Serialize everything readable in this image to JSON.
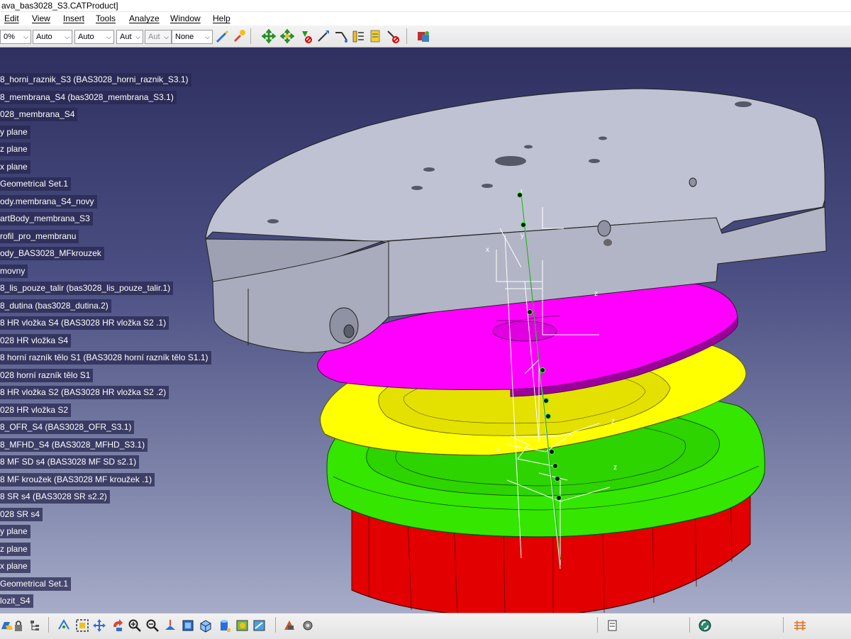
{
  "window": {
    "title": "ava_bas3028_S3.CATProduct]"
  },
  "menu": [
    "Edit",
    "View",
    "Insert",
    "Tools",
    "Analyze",
    "Window",
    "Help"
  ],
  "toolbar": {
    "zoom_value": "0%",
    "selects": [
      {
        "value": "Auto",
        "disabled": false
      },
      {
        "value": "Auto",
        "disabled": false
      },
      {
        "value": "Aut",
        "disabled": false
      },
      {
        "value": "Aut",
        "disabled": true
      },
      {
        "value": "None",
        "disabled": false
      }
    ]
  },
  "tree": {
    "items": [
      "8_horni_raznik_S3 (BAS3028_horni_raznik_S3.1)",
      "8_membrana_S4 (bas3028_membrana_S3.1)",
      "028_membrana_S4",
      "y plane",
      "z plane",
      "x plane",
      "Geometrical Set.1",
      "ody.membrana_S4_novy",
      "artBody_membrana_S3",
      "rofil_pro_membranu",
      "ody_BAS3028_MFkrouzek",
      "movny",
      "8_lis_pouze_talir (bas3028_lis_pouze_talir.1)",
      "8_dutina (bas3028_dutina.2)",
      "8 HR vložka S4 (BAS3028 HR vložka S2 .1)",
      "028 HR vložka S4",
      "8 horní razník tělo S1 (BAS3028 horní razník tělo S1.1)",
      "028 horní razník tělo S1",
      "8 HR vložka S2  (BAS3028 HR vložka S2 .2)",
      "028 HR vložka S2",
      "8_OFR_S4 (BAS3028_OFR_S3.1)",
      "8_MFHD_S4 (BAS3028_MFHD_S3.1)",
      "8 MF SD s4 (BAS3028 MF SD s2.1)",
      "8 MF kroužek  (BAS3028 MF kroužek .1)",
      "8 SR s4 (BAS3028 SR s2.2)",
      "028 SR s4",
      "y plane",
      "z plane",
      "x plane",
      "Geometrical Set.1",
      "lozit_S4"
    ]
  },
  "axis_labels": {
    "x": "x",
    "y": "y",
    "z": "z"
  },
  "colors": {
    "plate": "#b9bccc",
    "magenta": "#ff00ff",
    "yellow": "#ffff00",
    "green": "#33ee00",
    "red": "#ee0000",
    "bg_top": "#2f3060",
    "bg_bottom": "#a6acc8"
  },
  "icons": {
    "top": [
      "pen-brush-icon",
      "paint-brush-icon",
      "pan-icon",
      "rotate-icon",
      "select-filter-icon",
      "measure-icon",
      "line-icon",
      "scale-icon",
      "analysis-icon",
      "clear-icon",
      "catalog-icon"
    ],
    "bottom": [
      "flyout-icon",
      "select-icon",
      "lock-icon",
      "tree-icon",
      "compass-icon",
      "fit-all-icon",
      "move-icon",
      "rotate-view-icon",
      "zoom-in-icon",
      "zoom-out-icon",
      "normal-view-icon",
      "cube-view-icon",
      "box-icon",
      "cylinder-icon",
      "render-icon",
      "hide-icon",
      "snapshot-icon",
      "settings-icon",
      "sketch-icon",
      "swap-icon",
      "grid-icon"
    ]
  }
}
